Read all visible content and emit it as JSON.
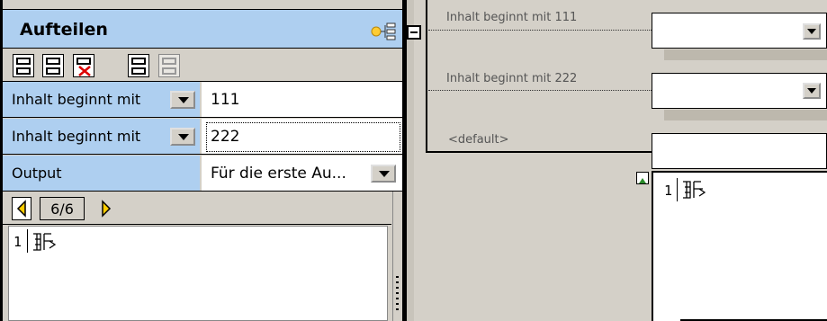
{
  "panel": {
    "title": "Aufteilen",
    "rows": [
      {
        "label": "Inhalt beginnt mit",
        "value": "111"
      },
      {
        "label": "Inhalt beginnt mit",
        "value": "222"
      },
      {
        "label": "Output",
        "value": "Für die erste Au..."
      }
    ],
    "pager": {
      "text": "6/6"
    },
    "code_line_number": "1"
  },
  "canvas": {
    "conditions": [
      {
        "label": "Inhalt beginnt mit 111"
      },
      {
        "label": "Inhalt beginnt mit 222"
      },
      {
        "label": "<default>"
      }
    ],
    "right_line_number": "1"
  }
}
